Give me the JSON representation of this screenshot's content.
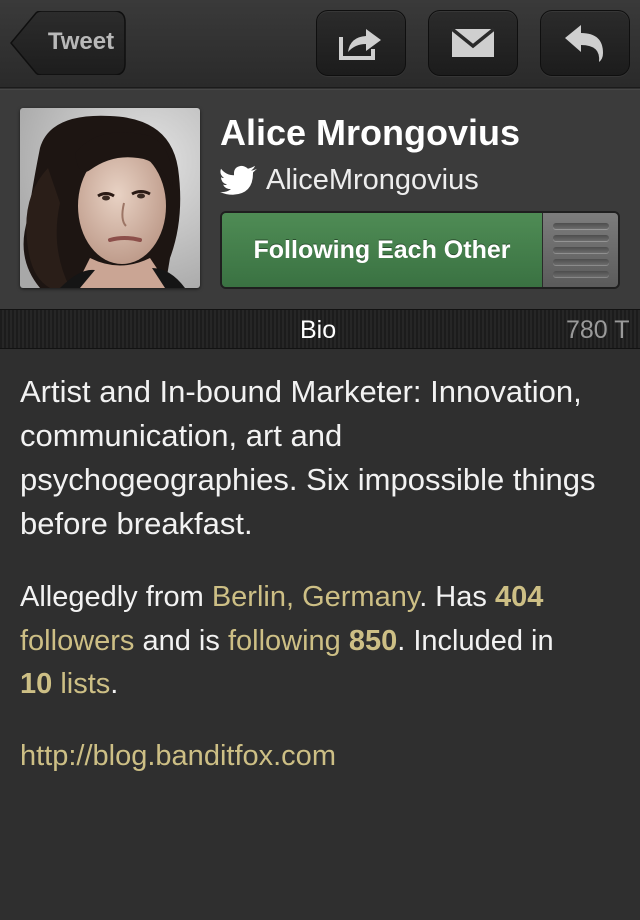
{
  "toolbar": {
    "back_label": "Tweet",
    "share_icon": "share-icon",
    "mail_icon": "mail-icon",
    "reply_icon": "reply-icon"
  },
  "profile": {
    "name": "Alice Mrongovius",
    "handle": "AliceMrongovius",
    "follow_status": "Following Each Other",
    "avatar": "profile-photo"
  },
  "tabs": {
    "bio": "Bio",
    "tweets": "780 T"
  },
  "bio": {
    "text": "Artist and In-bound Marketer: Innovation, communication, art and psychogeographies. Six impossible things before breakfast.",
    "prefix": "Allegedly from ",
    "location": "Berlin, Germany",
    "has": ". Has ",
    "followers_count": "404",
    "followers_label": "followers",
    "is_following": " and is ",
    "following_label": "following",
    "following_count": "850",
    "included": ". Included in ",
    "lists_count": "10",
    "lists_label": "lists",
    "end": ".",
    "url": "http://blog.banditfox.com"
  },
  "colors": {
    "link": "#cdbf85",
    "follow_green": "#3f7a47",
    "background": "#2f2f2f"
  }
}
